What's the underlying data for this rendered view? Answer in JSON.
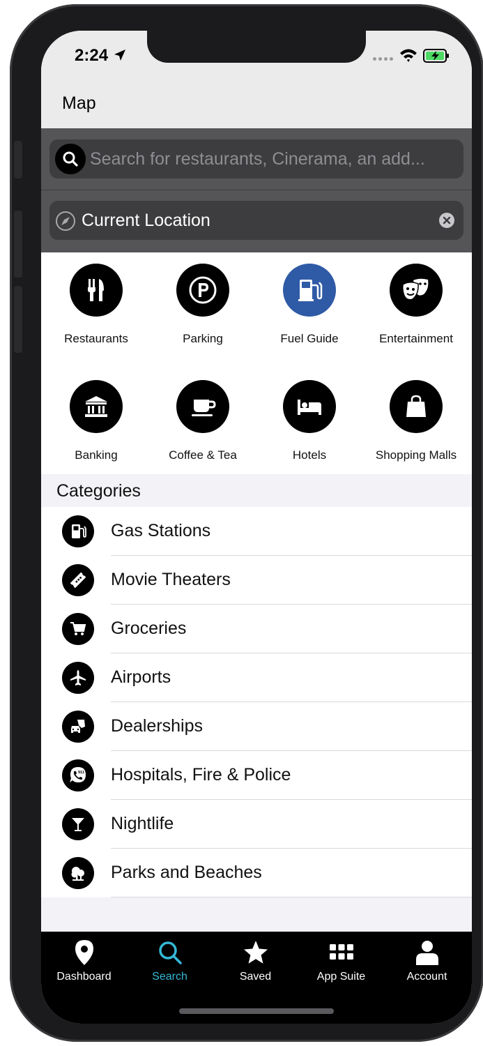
{
  "status_bar": {
    "time": "2:24"
  },
  "nav": {
    "title": "Map"
  },
  "search": {
    "placeholder": "Search for restaurants, Cinerama, an add...",
    "location_value": "Current Location"
  },
  "quick_items": [
    {
      "label": "Restaurants",
      "icon": "fork-knife-icon"
    },
    {
      "label": "Parking",
      "icon": "parking-icon"
    },
    {
      "label": "Fuel Guide",
      "icon": "fuel-pump-icon",
      "active": true
    },
    {
      "label": "Entertainment",
      "icon": "theater-masks-icon"
    },
    {
      "label": "Banking",
      "icon": "bank-icon"
    },
    {
      "label": "Coffee & Tea",
      "icon": "coffee-cup-icon"
    },
    {
      "label": "Hotels",
      "icon": "bed-icon"
    },
    {
      "label": "Shopping Malls",
      "icon": "shopping-bag-icon"
    }
  ],
  "categories": {
    "header": "Categories",
    "items": [
      {
        "label": "Gas Stations",
        "icon": "fuel-pump-icon"
      },
      {
        "label": "Movie Theaters",
        "icon": "ticket-icon"
      },
      {
        "label": "Groceries",
        "icon": "cart-icon"
      },
      {
        "label": "Airports",
        "icon": "airplane-icon"
      },
      {
        "label": "Dealerships",
        "icon": "car-tag-icon"
      },
      {
        "label": "Hospitals, Fire & Police",
        "icon": "emergency-911-icon"
      },
      {
        "label": "Nightlife",
        "icon": "cocktail-icon"
      },
      {
        "label": "Parks and Beaches",
        "icon": "tree-icon"
      }
    ]
  },
  "tabs": [
    {
      "label": "Dashboard",
      "icon": "map-pin-icon"
    },
    {
      "label": "Search",
      "icon": "search-icon",
      "active": true
    },
    {
      "label": "Saved",
      "icon": "star-icon"
    },
    {
      "label": "App Suite",
      "icon": "grid-icon"
    },
    {
      "label": "Account",
      "icon": "person-icon"
    }
  ],
  "colors": {
    "accent_active_tab": "#35b8d6",
    "active_quick_item": "#2f5aa6",
    "search_area_bg": "#555557",
    "battery_green": "#4cd964"
  }
}
